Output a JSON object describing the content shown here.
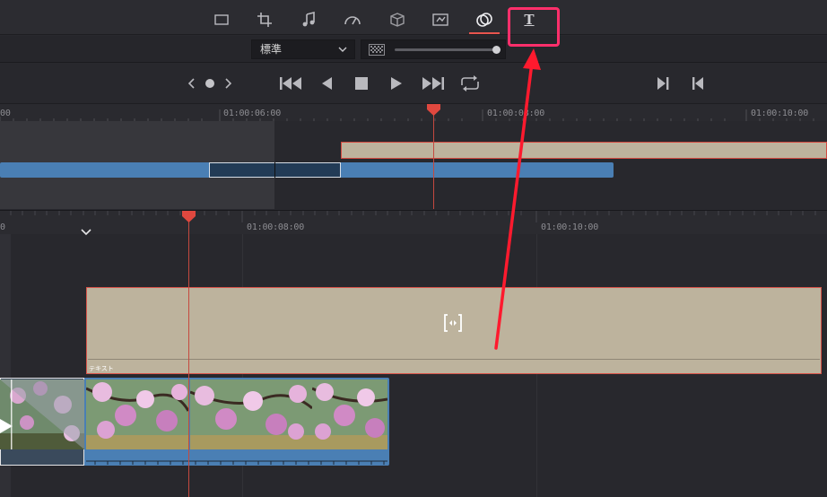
{
  "inspector": {
    "tools": [
      {
        "name": "transform-tool",
        "icon": "transform-icon"
      },
      {
        "name": "crop-tool",
        "icon": "crop-icon"
      },
      {
        "name": "audio-tool",
        "icon": "music-note-icon"
      },
      {
        "name": "speed-tool",
        "icon": "speedometer-icon"
      },
      {
        "name": "3d-tool",
        "icon": "cube-icon"
      },
      {
        "name": "stabilize-tool",
        "icon": "stabilize-icon"
      },
      {
        "name": "color-tool",
        "icon": "color-circles-icon",
        "active": true
      },
      {
        "name": "text-tool",
        "icon": "text-T-icon",
        "highlighted": true
      }
    ],
    "text_tool_label": "T"
  },
  "view_select": {
    "value": "標準"
  },
  "mini_timeline": {
    "timecodes": [
      "00",
      "01:00:06:00",
      "01:00:08:00",
      "01:00:10:00"
    ]
  },
  "main_timeline": {
    "timecodes": [
      "0",
      "01:00:08:00",
      "01:00:10:00"
    ],
    "text_clip_label": "テキスト"
  },
  "colors": {
    "accent": "#e8554e",
    "highlight": "#ff2f6b",
    "text_clip": "#bdb39d",
    "video_clip": "#4a7fb4",
    "playhead": "#e0483f"
  }
}
